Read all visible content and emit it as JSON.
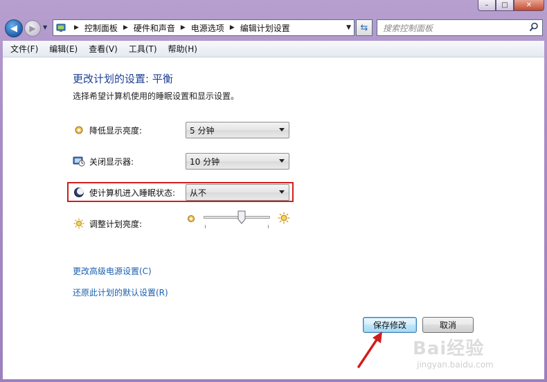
{
  "window": {
    "min_glyph": "–",
    "max_glyph": "□",
    "close_glyph": "✕"
  },
  "navbar": {
    "breadcrumbs": [
      "控制面板",
      "硬件和声音",
      "电源选项",
      "编辑计划设置"
    ],
    "search_placeholder": "搜索控制面板"
  },
  "menu": [
    "文件(F)",
    "编辑(E)",
    "查看(V)",
    "工具(T)",
    "帮助(H)"
  ],
  "page": {
    "title": "更改计划的设置: 平衡",
    "subtitle": "选择希望计算机使用的睡眠设置和显示设置。"
  },
  "settings": {
    "dim_display": {
      "label": "降低显示亮度:",
      "value": "5 分钟"
    },
    "turn_off_display": {
      "label": "关闭显示器:",
      "value": "10 分钟"
    },
    "sleep": {
      "label": "使计算机进入睡眠状态:",
      "value": "从不"
    },
    "brightness": {
      "label": "调整计划亮度:",
      "level_fraction": 0.57
    }
  },
  "links": {
    "advanced": "更改高级电源设置(C)",
    "restore": "还原此计划的默认设置(R)"
  },
  "buttons": {
    "save": "保存修改",
    "cancel": "取消"
  },
  "watermark": {
    "logo": "Bai经验",
    "url": "jingyan.baidu.com"
  },
  "colors": {
    "highlight_box": "#d31c1c",
    "annotation_arrow": "#d31c1c",
    "title": "#1c3f94",
    "link": "#1a5faf"
  }
}
